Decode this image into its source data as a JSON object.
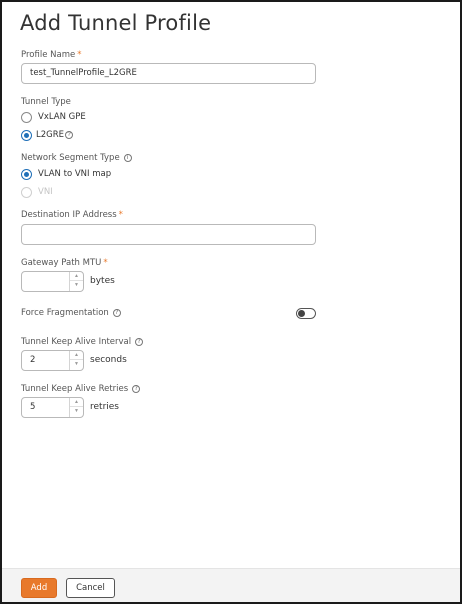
{
  "dialog": {
    "title": "Add Tunnel Profile"
  },
  "profile_name": {
    "label": "Profile Name",
    "required_mark": "*",
    "value": "test_TunnelProfile_L2GRE"
  },
  "tunnel_type": {
    "label": "Tunnel Type",
    "options": [
      {
        "label": "VxLAN GPE",
        "selected": false
      },
      {
        "label": "L2GRE",
        "selected": true,
        "help_icon": "question-circle-icon"
      }
    ]
  },
  "network_segment_type": {
    "label": "Network Segment Type",
    "help_icon": "info-circle-icon",
    "options": [
      {
        "label": "VLAN to VNI map",
        "selected": true,
        "disabled": false
      },
      {
        "label": "VNI",
        "selected": false,
        "disabled": true
      }
    ]
  },
  "destination_ip": {
    "label": "Destination IP Address",
    "required_mark": "*",
    "value": ""
  },
  "gateway_path_mtu": {
    "label": "Gateway Path MTU",
    "required_mark": "*",
    "value": "",
    "unit": "bytes"
  },
  "force_fragmentation": {
    "label": "Force Fragmentation",
    "help_icon": "question-circle-icon",
    "enabled": false
  },
  "keep_alive_interval": {
    "label": "Tunnel Keep Alive Interval",
    "help_icon": "question-circle-icon",
    "value": "2",
    "unit": "seconds"
  },
  "keep_alive_retries": {
    "label": "Tunnel Keep Alive Retries",
    "help_icon": "question-circle-icon",
    "value": "5",
    "unit": "retries"
  },
  "footer": {
    "add_label": "Add",
    "cancel_label": "Cancel"
  },
  "colors": {
    "accent": "#e8792b",
    "radio_selected": "#1f6fb8"
  }
}
